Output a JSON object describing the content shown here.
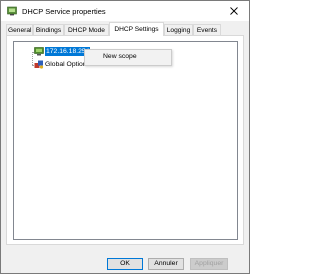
{
  "window": {
    "title": "DHCP Service properties"
  },
  "tabs": [
    {
      "label": "General"
    },
    {
      "label": "Bindings"
    },
    {
      "label": "DHCP Mode"
    },
    {
      "label": "DHCP Settings",
      "active": true
    },
    {
      "label": "Logging"
    },
    {
      "label": "Events"
    }
  ],
  "tree": {
    "nodes": [
      {
        "label": "172.16.18.254",
        "icon": "network-scope-icon",
        "selected": true
      },
      {
        "label": "Global Options",
        "icon": "global-options-icon",
        "selected": false
      }
    ]
  },
  "context_menu": {
    "items": [
      {
        "label": "New scope"
      }
    ]
  },
  "buttons": {
    "ok": "OK",
    "cancel": "Annuler",
    "apply": "Appliquer"
  },
  "colors": {
    "selection": "#0078d7",
    "window_bg": "#f0f0f0",
    "panel_bg": "#ffffff"
  }
}
